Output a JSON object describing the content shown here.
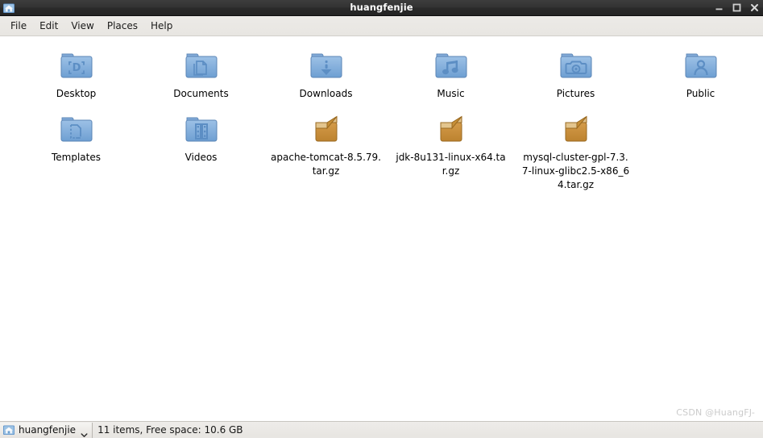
{
  "window": {
    "title": "huangfenjie",
    "titlebar_icon": "home-folder-icon",
    "controls": [
      {
        "name": "minimize-button",
        "glyph": "minimize-icon"
      },
      {
        "name": "maximize-button",
        "glyph": "maximize-icon"
      },
      {
        "name": "close-button",
        "glyph": "close-icon"
      }
    ]
  },
  "menubar": {
    "items": [
      {
        "label": "File"
      },
      {
        "label": "Edit"
      },
      {
        "label": "View"
      },
      {
        "label": "Places"
      },
      {
        "label": "Help"
      }
    ]
  },
  "files": [
    {
      "label": "Desktop",
      "kind": "folder",
      "emblem": "desktop-d-icon"
    },
    {
      "label": "Documents",
      "kind": "folder",
      "emblem": "documents-pages-icon"
    },
    {
      "label": "Downloads",
      "kind": "folder",
      "emblem": "downloads-arrow-icon"
    },
    {
      "label": "Music",
      "kind": "folder",
      "emblem": "music-note-icon"
    },
    {
      "label": "Pictures",
      "kind": "folder",
      "emblem": "camera-icon"
    },
    {
      "label": "Public",
      "kind": "folder",
      "emblem": "person-icon"
    },
    {
      "label": "Templates",
      "kind": "folder",
      "emblem": "template-document-icon"
    },
    {
      "label": "Videos",
      "kind": "folder",
      "emblem": "film-strip-icon"
    },
    {
      "label": "apache-tomcat-8.5.79.tar.gz",
      "kind": "archive",
      "emblem": "package-icon"
    },
    {
      "label": "jdk-8u131-linux-x64.tar.gz",
      "kind": "archive",
      "emblem": "package-icon"
    },
    {
      "label": "mysql-cluster-gpl-7.3.7-linux-glibc2.5-x86_64.tar.gz",
      "kind": "archive",
      "emblem": "package-icon"
    }
  ],
  "statusbar": {
    "path_label": "huangfenjie",
    "path_icon": "home-folder-icon",
    "chevron": "chevron-down-icon",
    "summary": "11 items, Free space: 10.6 GB"
  },
  "watermark": {
    "text": "CSDN @HuangFJ-"
  },
  "colors": {
    "titlebar_bg": "#2d2d2d",
    "menubar_bg": "#eceae7",
    "content_bg": "#ffffff",
    "statusbar_bg": "#e9e7e3",
    "folder_blue": "#7ba7d7",
    "archive_orange": "#c98e38",
    "watermark_gray": "#cbcbcb"
  }
}
